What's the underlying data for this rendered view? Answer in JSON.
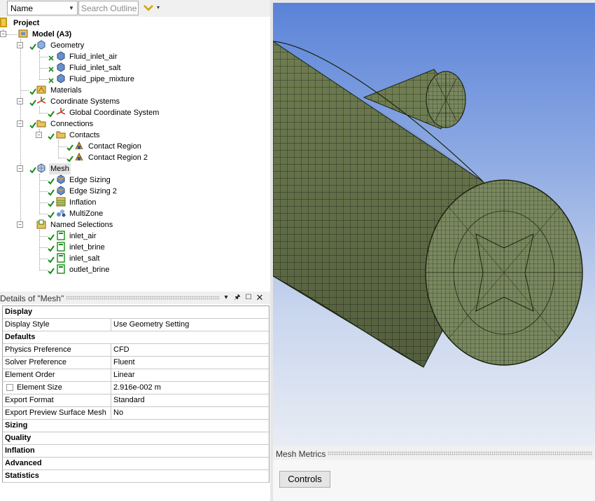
{
  "toolbar": {
    "name_combo_value": "Name",
    "search_placeholder": "Search Outline",
    "filter_icon": "chevron-down-icon"
  },
  "tree": {
    "project": "Project",
    "model": "Model (A3)",
    "geometry": "Geometry",
    "geometry_children": [
      "Fluid_inlet_air",
      "Fluid_inlet_salt",
      "Fluid_pipe_mixture"
    ],
    "materials": "Materials",
    "coordinate_systems": "Coordinate Systems",
    "global_cs": "Global Coordinate System",
    "connections": "Connections",
    "contacts": "Contacts",
    "contact_regions": [
      "Contact Region",
      "Contact Region 2"
    ],
    "mesh": "Mesh",
    "mesh_children": [
      "Edge Sizing",
      "Edge Sizing 2",
      "Inflation",
      "MultiZone"
    ],
    "named_selections": "Named Selections",
    "named_children": [
      "inlet_air",
      "inlet_brine",
      "inlet_salt",
      "outlet_brine"
    ]
  },
  "details": {
    "title": "Details of \"Mesh\"",
    "rows": [
      {
        "type": "cat",
        "key": "Display"
      },
      {
        "type": "prop",
        "key": "Display Style",
        "value": "Use Geometry Setting"
      },
      {
        "type": "cat",
        "key": "Defaults"
      },
      {
        "type": "prop",
        "key": "Physics Preference",
        "value": "CFD"
      },
      {
        "type": "prop",
        "key": "Solver Preference",
        "value": "Fluent"
      },
      {
        "type": "prop",
        "key": "Element Order",
        "value": "Linear"
      },
      {
        "type": "check",
        "key": "Element Size",
        "value": "2.916e-002 m"
      },
      {
        "type": "prop",
        "key": "Export Format",
        "value": "Standard"
      },
      {
        "type": "prop",
        "key": "Export Preview Surface Mesh",
        "value": "No"
      },
      {
        "type": "cat",
        "key": "Sizing"
      },
      {
        "type": "cat",
        "key": "Quality"
      },
      {
        "type": "cat",
        "key": "Inflation"
      },
      {
        "type": "cat",
        "key": "Advanced"
      },
      {
        "type": "cat",
        "key": "Statistics"
      }
    ]
  },
  "metrics": {
    "title": "Mesh Metrics",
    "controls_label": "Controls"
  },
  "colors": {
    "mesh_face": "#6f7d52",
    "mesh_line": "#1c2410",
    "sky_top": "#5a83d8",
    "sky_bottom": "#e8ecf4"
  }
}
